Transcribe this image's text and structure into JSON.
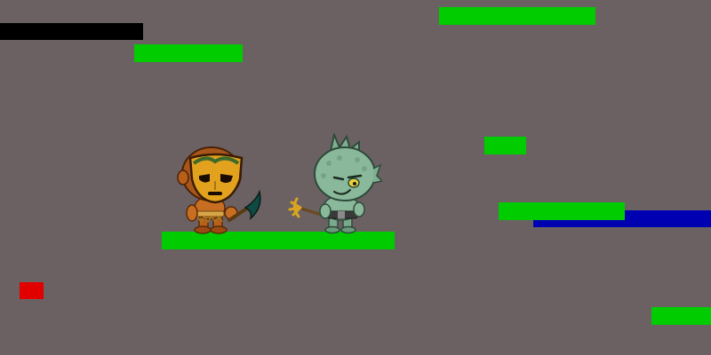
{
  "scene": {
    "background_color": "#6b6163",
    "colors": {
      "platform": "#00cc00",
      "wall": "#000000",
      "water": "#0000b3",
      "hazard": "#e00000"
    }
  },
  "platforms": [
    {
      "name": "platform-top-right"
    },
    {
      "name": "platform-upper-left"
    },
    {
      "name": "platform-small-mid-right"
    },
    {
      "name": "platform-right"
    },
    {
      "name": "platform-center"
    },
    {
      "name": "platform-bottom-right"
    }
  ],
  "obstacles": [
    {
      "name": "black-wall-block",
      "kind": "wall"
    },
    {
      "name": "blue-water-block",
      "kind": "water"
    },
    {
      "name": "red-hazard-block",
      "kind": "hazard"
    }
  ],
  "characters": [
    {
      "name": "tribal-mask-warrior",
      "weapon": "scythe-icon"
    },
    {
      "name": "sea-creature-warrior",
      "weapon": "trident-icon"
    }
  ]
}
